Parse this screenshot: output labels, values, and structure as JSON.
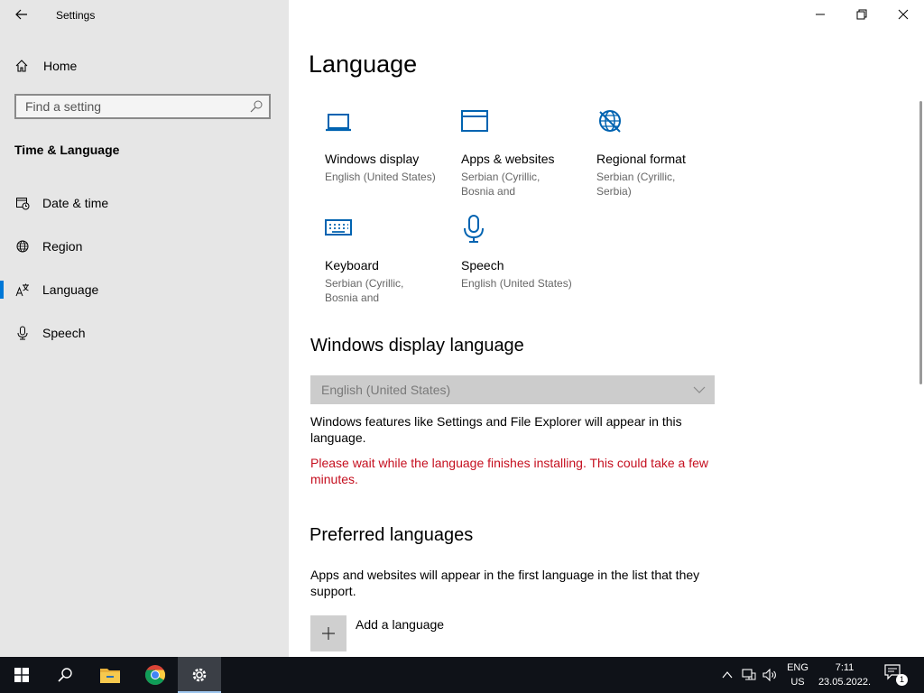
{
  "app": {
    "title": "Settings"
  },
  "sidebar": {
    "home_label": "Home",
    "search_placeholder": "Find a setting",
    "section_title": "Time & Language",
    "items": [
      {
        "label": "Date & time",
        "icon": "calendar-clock-icon"
      },
      {
        "label": "Region",
        "icon": "globe-icon"
      },
      {
        "label": "Language",
        "icon": "language-icon",
        "active": true
      },
      {
        "label": "Speech",
        "icon": "microphone-icon"
      }
    ]
  },
  "main": {
    "title": "Language",
    "tiles": [
      {
        "name": "Windows display",
        "desc": "English (United States)",
        "icon": "laptop-icon"
      },
      {
        "name": "Apps & websites",
        "desc": "Serbian (Cyrillic, Bosnia and",
        "icon": "browser-window-icon"
      },
      {
        "name": "Regional format",
        "desc": "Serbian (Cyrillic, Serbia)",
        "icon": "globe-format-icon"
      },
      {
        "name": "Keyboard",
        "desc": "Serbian (Cyrillic, Bosnia and",
        "icon": "keyboard-icon"
      },
      {
        "name": "Speech",
        "desc": "English (United States)",
        "icon": "microphone-icon"
      }
    ],
    "display_language": {
      "heading": "Windows display language",
      "selected": "English (United States)",
      "info": "Windows features like Settings and File Explorer will appear in this language.",
      "warning": "Please wait while the language finishes installing. This could take a few minutes."
    },
    "preferred": {
      "heading": "Preferred languages",
      "info": "Apps and websites will appear in the first language in the list that they support.",
      "add_label": "Add a language"
    }
  },
  "taskbar": {
    "apps": [
      "start-icon",
      "search-icon",
      "file-explorer-icon",
      "chrome-icon",
      "settings-icon"
    ],
    "lang_line1": "ENG",
    "lang_line2": "US",
    "time": "7:11",
    "date": "23.05.2022.",
    "notification_count": "1"
  },
  "colors": {
    "accent": "#0078d7",
    "warning": "#c50f1f",
    "sidebar_bg": "#e6e6e6",
    "taskbar_bg": "#0f1218"
  }
}
